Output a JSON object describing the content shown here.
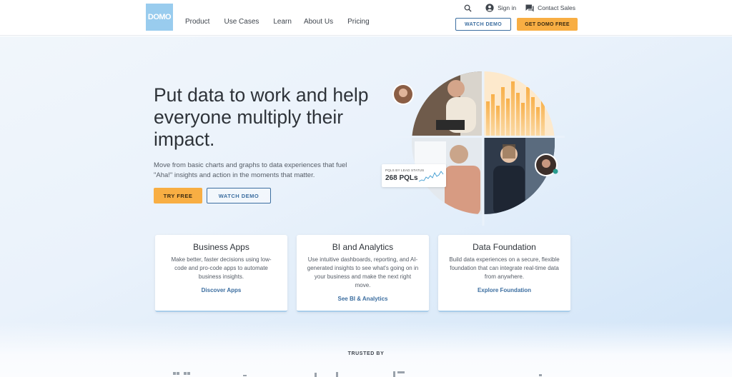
{
  "header": {
    "logo_text": "DOMO",
    "nav": [
      "Product",
      "Use Cases",
      "Learn",
      "About Us",
      "Pricing"
    ],
    "sign_in": "Sign in",
    "contact_sales": "Contact Sales",
    "watch_demo": "WATCH DEMO",
    "get_domo_free": "GET DOMO FREE"
  },
  "hero": {
    "headline": "Put data to work and help everyone multiply their impact.",
    "subtext": "Move from basic charts and graphs to data experiences that fuel \"Aha!\" insights and action in the moments that matter.",
    "try_free": "TRY FREE",
    "watch_demo": "WATCH DEMO",
    "stat_label": "PQLS BY LEAD STATUS",
    "stat_value": "268 PQLs"
  },
  "cards": [
    {
      "title": "Business Apps",
      "body": "Make better, faster decisions using low-code and pro-code apps to automate business insights.",
      "link": "Discover Apps"
    },
    {
      "title": "BI and Analytics",
      "body": "Use intuitive dashboards, reporting, and AI-generated insights to see what's going on in your business and make the next right move.",
      "link": "See BI & Analytics"
    },
    {
      "title": "Data Foundation",
      "body": "Build data experiences on a secure, flexible foundation that can integrate real-time data from anywhere.",
      "link": "Explore Foundation"
    }
  ],
  "trusted_by": "TRUSTED BY",
  "colors": {
    "brand_blue": "#99ccee",
    "accent_orange": "#f8ae43",
    "link_blue": "#3c6ea0"
  },
  "icons": [
    "search-icon",
    "account-icon",
    "chat-icon"
  ]
}
